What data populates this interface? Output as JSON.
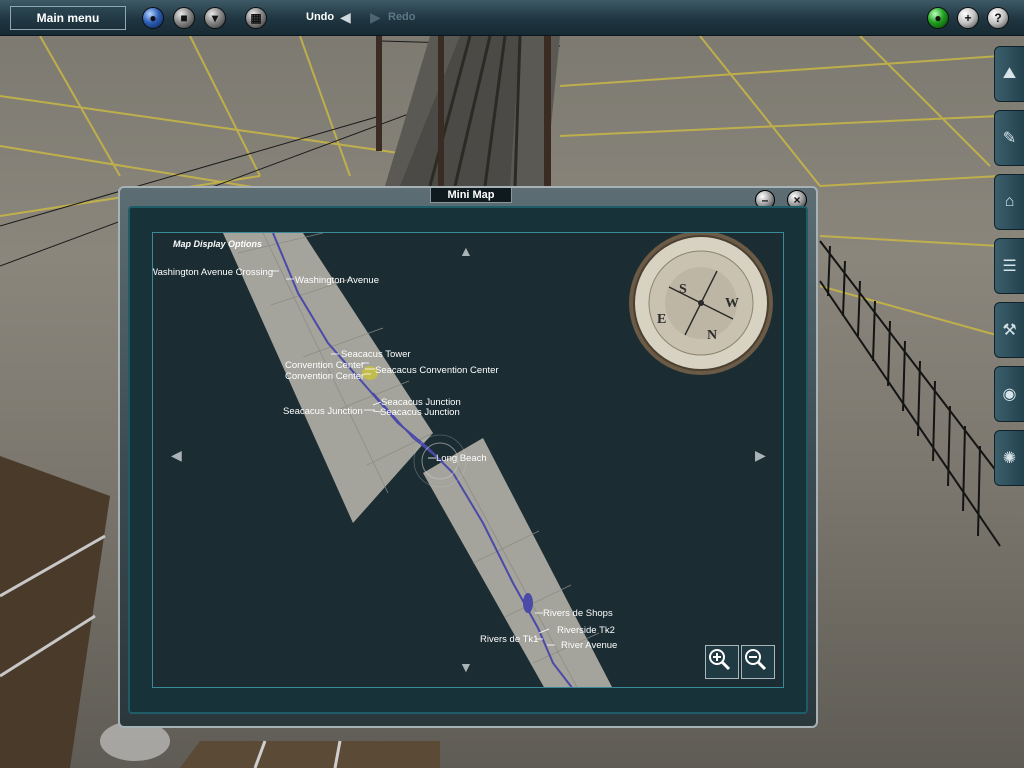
{
  "toolbar": {
    "main_menu": "Main menu",
    "undo": "Undo",
    "redo": "Redo",
    "help_glyph": "?",
    "add_glyph": "+"
  },
  "minimap": {
    "title": "Mini Map",
    "options_link": "Map Display Options",
    "minimize_glyph": "–",
    "close_glyph": "×",
    "compass_marks": [
      "N",
      "E",
      "S",
      "W"
    ],
    "labels": {
      "washington_avenue_crossing": "Washington Avenue Crossing",
      "washington_avenue": "Washington Avenue",
      "seacacus_tower": "Seacacus Tower",
      "convention_center_1": "Convention Center",
      "convention_center_2": "Convention Center",
      "seacacus_convention_center": "Seacacus Convention Center",
      "seacacus_junction_left": "Seacacus Junction",
      "seacacus_junction_right_1": "Seacacus Junction",
      "seacacus_junction_right_2": "Seacacus Junction",
      "long_beach": "Long Beach",
      "rivers_de_shops": "Rivers de Shops",
      "riverside_tk2": "Riverside Tk2",
      "rivers_de_tk1": "Rivers de Tk1",
      "river_avenue": "River Avenue"
    }
  },
  "icons": {
    "side_tabs": [
      "terrain-icon",
      "paint-icon",
      "objects-icon",
      "track-icon",
      "tools-icon",
      "globe-icon",
      "wheel-icon"
    ]
  },
  "colors": {
    "toolbar_bg": "#1f3540",
    "map_bg": "#1b2c33",
    "map_strip": "#b9b6aa",
    "track_line": "#4a4aa8"
  }
}
